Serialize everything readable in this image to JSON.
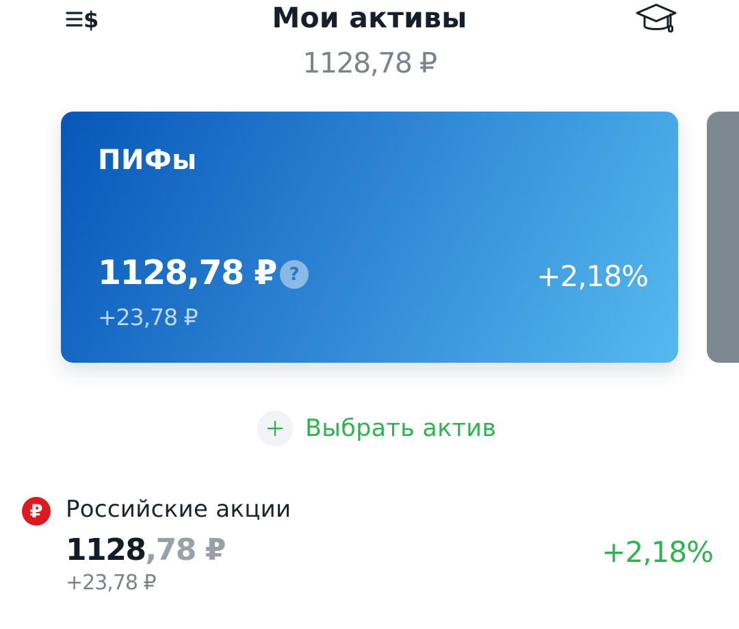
{
  "header": {
    "title": "Мои активы",
    "total": "1128,78 ₽",
    "menu_icon": "menu-dollar-icon",
    "education_icon": "graduation-cap-icon"
  },
  "cards": [
    {
      "title": "ПИФы",
      "amount": "1128,78 ₽",
      "help": "?",
      "delta": "+23,78 ₽",
      "percent": "+2,18%"
    }
  ],
  "add_asset": {
    "icon": "plus-icon",
    "label": "Выбрать актив"
  },
  "assets": [
    {
      "icon": "ruble-icon",
      "badge": "₽",
      "name": "Российские акции",
      "amount_int": "1128",
      "amount_frac": ",78 ₽",
      "delta": "+23,78 ₽",
      "percent": "+2,18%"
    }
  ],
  "colors": {
    "accent_green": "#2fb350",
    "card_gradient_start": "#0757b8",
    "card_gradient_end": "#56b9ef",
    "ruble_badge": "#dd1a22",
    "next_card": "#7e8891"
  }
}
